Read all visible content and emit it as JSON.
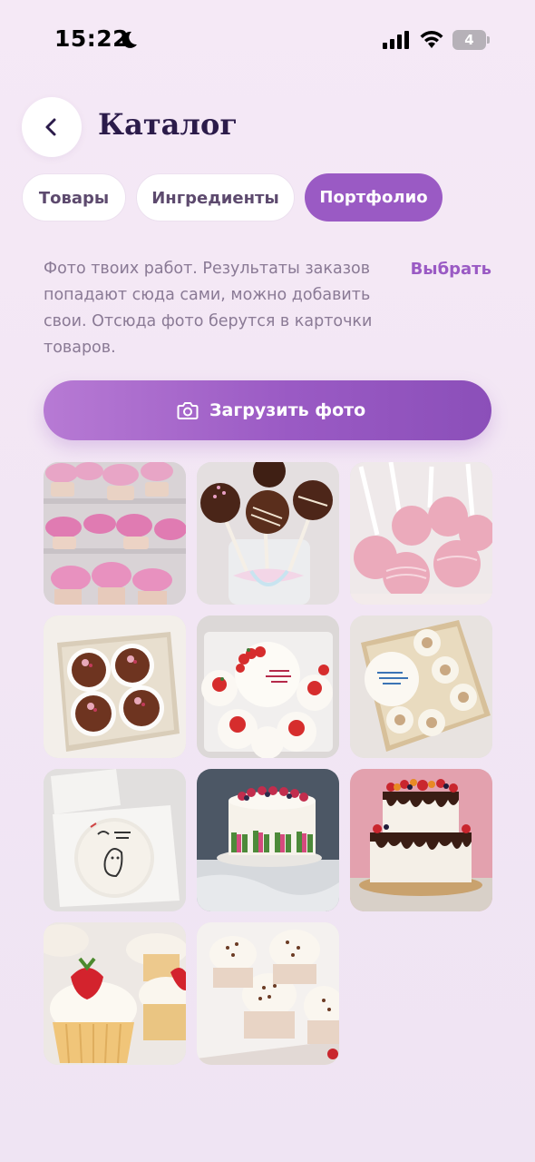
{
  "status_bar": {
    "time": "15:22",
    "battery_level": "4",
    "icons": [
      "moon-icon",
      "signal-icon",
      "wifi-icon",
      "battery-icon"
    ]
  },
  "header": {
    "back_icon": "chevron-left-icon",
    "title": "Каталог"
  },
  "tabs": [
    {
      "label": "Товары",
      "active": false
    },
    {
      "label": "Ингредиенты",
      "active": false
    },
    {
      "label": "Портфолио",
      "active": true
    }
  ],
  "portfolio": {
    "description": "Фото твоих работ. Результаты заказов попадают сюда сами, можно добавить свои. Отсюда фото берутся в карточки товаров.",
    "select_label": "Выбрать",
    "upload_label": "Загрузить фото",
    "upload_icon": "camera-icon",
    "photos": [
      {
        "subject": "pink cupcakes tower"
      },
      {
        "subject": "chocolate cake pops"
      },
      {
        "subject": "pink cake pops"
      },
      {
        "subject": "chocolate truffles box"
      },
      {
        "subject": "strawberry bento cake"
      },
      {
        "subject": "birthday bento cupcakes box"
      },
      {
        "subject": "bento cake in box"
      },
      {
        "subject": "berry decorated cake"
      },
      {
        "subject": "two-tier drip cake"
      },
      {
        "subject": "strawberry cupcakes"
      },
      {
        "subject": "chocolate cream cupcakes"
      }
    ]
  },
  "colors": {
    "accent": "#9a5ac4",
    "background": "#f4e8f5",
    "title": "#2b1b4a",
    "muted_text": "#8a7a95"
  }
}
